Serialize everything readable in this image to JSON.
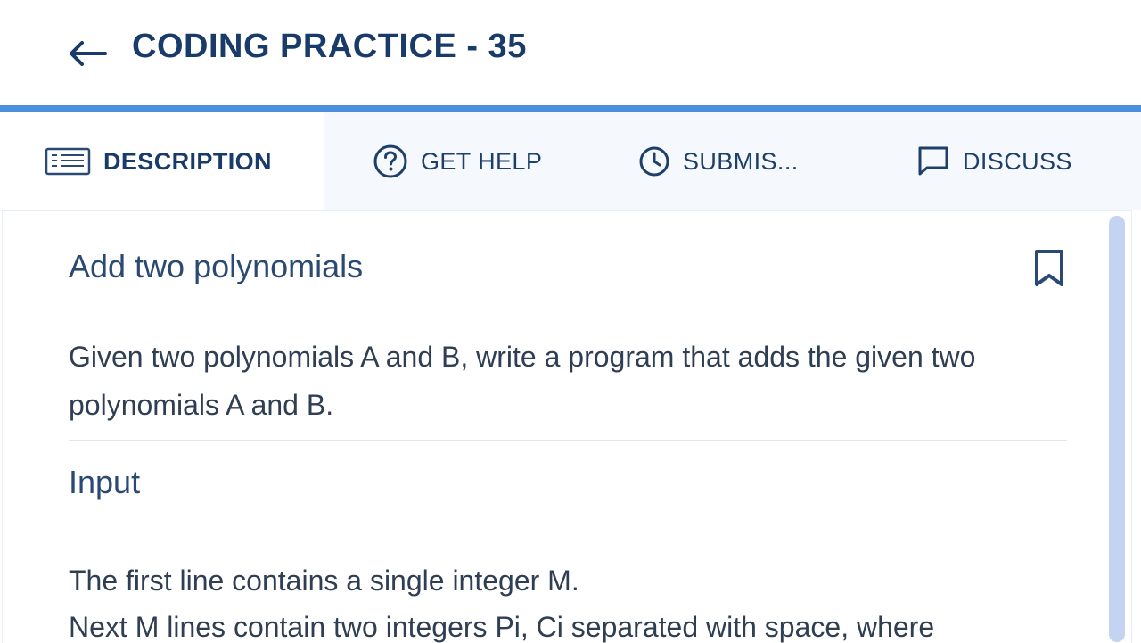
{
  "header": {
    "back_icon": "arrow-left-icon",
    "title": "CODING PRACTICE - 35"
  },
  "tabs": [
    {
      "label": "DESCRIPTION",
      "icon": "document-icon",
      "active": true
    },
    {
      "label": "GET HELP",
      "icon": "question-circle-icon",
      "active": false
    },
    {
      "label": "SUBMIS...",
      "icon": "clock-icon",
      "active": false
    },
    {
      "label": "DISCUSS",
      "icon": "chat-bubble-icon",
      "active": false
    }
  ],
  "problem": {
    "title": "Add two polynomials",
    "bookmark_icon": "bookmark-icon",
    "description": "Given two polynomials A and B, write a program that adds the given two polynomials A and B.",
    "input_heading": "Input",
    "input_lines": [
      "The first line contains a single integer M.",
      "Next M lines contain two integers Pi, Ci separated with space, where"
    ]
  },
  "colors": {
    "accent": "#4a8fdc",
    "title_text": "#183b69",
    "tabbar_bg": "#f5f9fd"
  }
}
